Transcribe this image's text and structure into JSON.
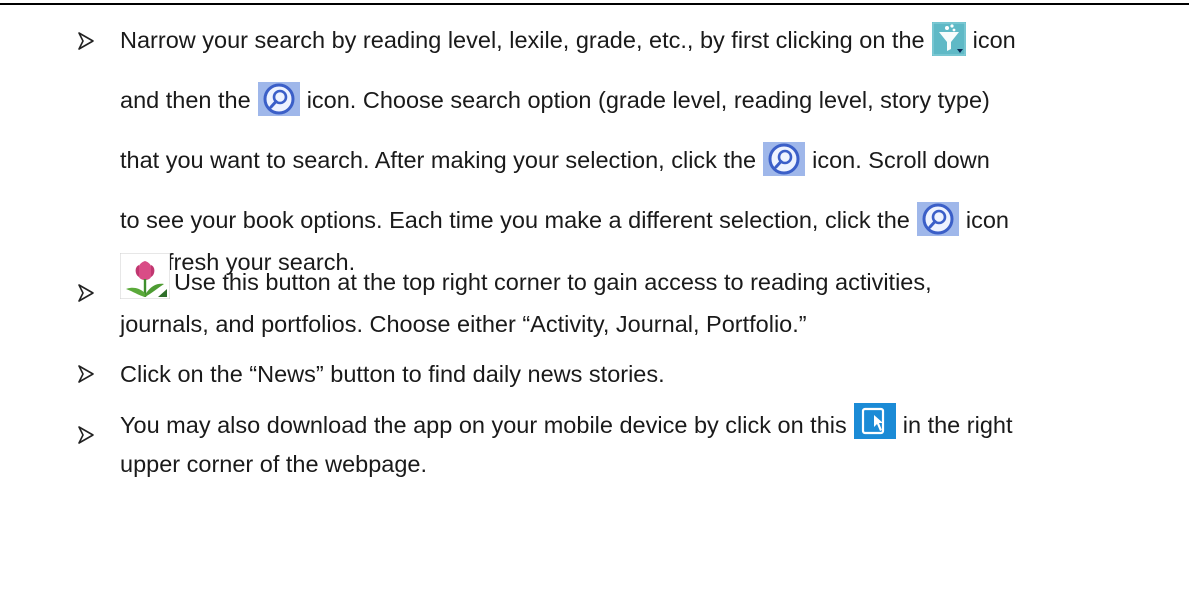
{
  "bullets": [
    {
      "segments": [
        "Narrow your search by reading level, lexile, grade, etc., by first clicking on the",
        "icon",
        "and then the",
        "icon. Choose search option (grade level, reading level, story type)",
        "that you want to search.  After making your selection, click the",
        "icon.  Scroll down",
        "to see your book options.  Each time you make a different selection, click the",
        "icon",
        "to refresh your search."
      ]
    },
    {
      "line1": "Use this button at the top right corner to gain access to reading activities,",
      "line2": "journals, and portfolios. Choose either “Activity, Journal, Portfolio.”"
    },
    {
      "text": "Click on the “News” button to find daily news stories."
    },
    {
      "before": "You may also download the app on your mobile device by click on this",
      "after": "in the right",
      "line2": "upper corner of the webpage."
    }
  ],
  "icons": {
    "filter": "filter-icon",
    "search": "search-icon",
    "tulip": "tulip-icon",
    "app": "app-download-icon"
  },
  "colors": {
    "filter_bg": "#5fb9c6",
    "search_ring": "#3b5fc8",
    "app_bg": "#1b8bd6"
  }
}
